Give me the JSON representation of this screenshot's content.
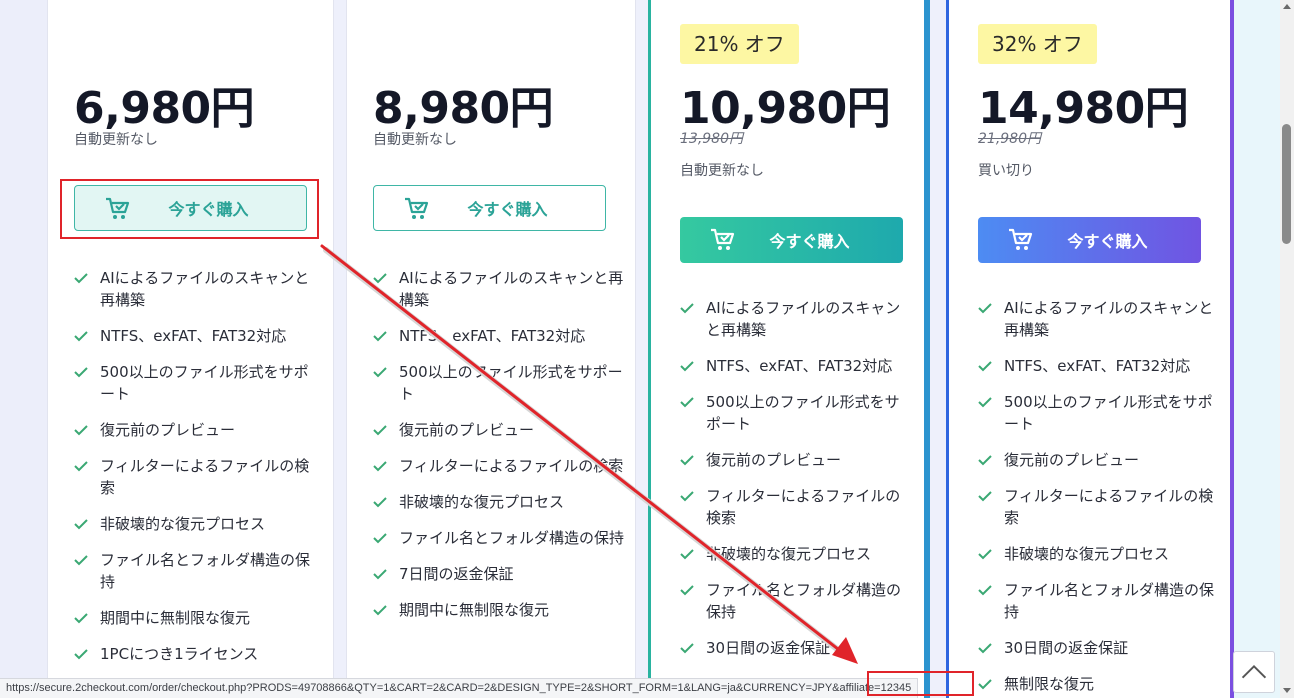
{
  "plans": [
    {
      "price": "6,980円",
      "original_price": "",
      "note": "自動更新なし",
      "badge": "",
      "buy_label": "今すぐ購入",
      "features": [
        "AIによるファイルのスキャンと再構築",
        "NTFS、exFAT、FAT32対応",
        "500以上のファイル形式をサポート",
        "復元前のプレビュー",
        "フィルターによるファイルの検索",
        "非破壊的な復元プロセス",
        "ファイル名とフォルダ構造の保持",
        "期間中に無制限な復元",
        "1PCにつき1ライセンス"
      ]
    },
    {
      "price": "8,980円",
      "original_price": "",
      "note": "自動更新なし",
      "badge": "",
      "buy_label": "今すぐ購入",
      "features": [
        "AIによるファイルのスキャンと再構築",
        "NTFS、exFAT、FAT32対応",
        "500以上のファイル形式をサポート",
        "復元前のプレビュー",
        "フィルターによるファイルの検索",
        "非破壊的な復元プロセス",
        "ファイル名とフォルダ構造の保持",
        "7日間の返金保証",
        "期間中に無制限な復元"
      ]
    },
    {
      "price": "10,980円",
      "original_price": "13,980円",
      "note": "自動更新なし",
      "badge": "21% オフ",
      "buy_label": "今すぐ購入",
      "features": [
        "AIによるファイルのスキャンと再構築",
        "NTFS、exFAT、FAT32対応",
        "500以上のファイル形式をサポート",
        "復元前のプレビュー",
        "フィルターによるファイルの検索",
        "非破壊的な復元プロセス",
        "ファイル名とフォルダ構造の保持",
        "30日間の返金保証"
      ]
    },
    {
      "price": "14,980円",
      "original_price": "21,980円",
      "note": "買い切り",
      "badge": "32% オフ",
      "buy_label": "今すぐ購入",
      "features": [
        "AIによるファイルのスキャンと再構築",
        "NTFS、exFAT、FAT32対応",
        "500以上のファイル形式をサポート",
        "復元前のプレビュー",
        "フィルターによるファイルの検索",
        "非破壊的な復元プロセス",
        "ファイル名とフォルダ構造の保持",
        "30日間の返金保証",
        "無制限な復元"
      ]
    }
  ],
  "status_bar": {
    "url": "https://secure.2checkout.com/order/checkout.php?PRODS=49708866&QTY=1&CART=2&CARD=2&DESIGN_TYPE=2&SHORT_FORM=1&LANG=ja&CURRENCY=JPY&affiliate=12345"
  },
  "colors": {
    "accent_teal": "#2ba397",
    "gradient_teal": [
      "#35c9a0",
      "#1ea9ad"
    ],
    "gradient_blue": [
      "#4d8cf3",
      "#7054e2"
    ],
    "badge_yellow": "#fdf7a3",
    "annotation_red": "#e0242a",
    "check_green": "#3aa873"
  },
  "icons": [
    "cart-check-icon",
    "check-icon",
    "chevron-up-icon"
  ]
}
